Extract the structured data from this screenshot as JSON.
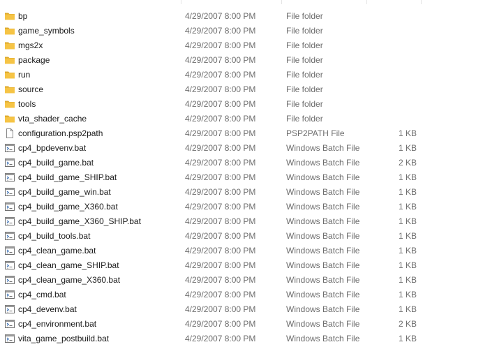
{
  "files": [
    {
      "name": "bp",
      "date": "4/29/2007 8:00 PM",
      "type": "File folder",
      "size": "",
      "icon": "folder-icon"
    },
    {
      "name": "game_symbols",
      "date": "4/29/2007 8:00 PM",
      "type": "File folder",
      "size": "",
      "icon": "folder-icon"
    },
    {
      "name": "mgs2x",
      "date": "4/29/2007 8:00 PM",
      "type": "File folder",
      "size": "",
      "icon": "folder-icon"
    },
    {
      "name": "package",
      "date": "4/29/2007 8:00 PM",
      "type": "File folder",
      "size": "",
      "icon": "folder-icon"
    },
    {
      "name": "run",
      "date": "4/29/2007 8:00 PM",
      "type": "File folder",
      "size": "",
      "icon": "folder-icon"
    },
    {
      "name": "source",
      "date": "4/29/2007 8:00 PM",
      "type": "File folder",
      "size": "",
      "icon": "folder-icon"
    },
    {
      "name": "tools",
      "date": "4/29/2007 8:00 PM",
      "type": "File folder",
      "size": "",
      "icon": "folder-icon"
    },
    {
      "name": "vta_shader_cache",
      "date": "4/29/2007 8:00 PM",
      "type": "File folder",
      "size": "",
      "icon": "folder-icon"
    },
    {
      "name": "configuration.psp2path",
      "date": "4/29/2007 8:00 PM",
      "type": "PSP2PATH File",
      "size": "1 KB",
      "icon": "file-icon"
    },
    {
      "name": "cp4_bpdevenv.bat",
      "date": "4/29/2007 8:00 PM",
      "type": "Windows Batch File",
      "size": "1 KB",
      "icon": "batch-file-icon"
    },
    {
      "name": "cp4_build_game.bat",
      "date": "4/29/2007 8:00 PM",
      "type": "Windows Batch File",
      "size": "2 KB",
      "icon": "batch-file-icon"
    },
    {
      "name": "cp4_build_game_SHIP.bat",
      "date": "4/29/2007 8:00 PM",
      "type": "Windows Batch File",
      "size": "1 KB",
      "icon": "batch-file-icon"
    },
    {
      "name": "cp4_build_game_win.bat",
      "date": "4/29/2007 8:00 PM",
      "type": "Windows Batch File",
      "size": "1 KB",
      "icon": "batch-file-icon"
    },
    {
      "name": "cp4_build_game_X360.bat",
      "date": "4/29/2007 8:00 PM",
      "type": "Windows Batch File",
      "size": "1 KB",
      "icon": "batch-file-icon"
    },
    {
      "name": "cp4_build_game_X360_SHIP.bat",
      "date": "4/29/2007 8:00 PM",
      "type": "Windows Batch File",
      "size": "1 KB",
      "icon": "batch-file-icon"
    },
    {
      "name": "cp4_build_tools.bat",
      "date": "4/29/2007 8:00 PM",
      "type": "Windows Batch File",
      "size": "1 KB",
      "icon": "batch-file-icon"
    },
    {
      "name": "cp4_clean_game.bat",
      "date": "4/29/2007 8:00 PM",
      "type": "Windows Batch File",
      "size": "1 KB",
      "icon": "batch-file-icon"
    },
    {
      "name": "cp4_clean_game_SHIP.bat",
      "date": "4/29/2007 8:00 PM",
      "type": "Windows Batch File",
      "size": "1 KB",
      "icon": "batch-file-icon"
    },
    {
      "name": "cp4_clean_game_X360.bat",
      "date": "4/29/2007 8:00 PM",
      "type": "Windows Batch File",
      "size": "1 KB",
      "icon": "batch-file-icon"
    },
    {
      "name": "cp4_cmd.bat",
      "date": "4/29/2007 8:00 PM",
      "type": "Windows Batch File",
      "size": "1 KB",
      "icon": "batch-file-icon"
    },
    {
      "name": "cp4_devenv.bat",
      "date": "4/29/2007 8:00 PM",
      "type": "Windows Batch File",
      "size": "1 KB",
      "icon": "batch-file-icon"
    },
    {
      "name": "cp4_environment.bat",
      "date": "4/29/2007 8:00 PM",
      "type": "Windows Batch File",
      "size": "2 KB",
      "icon": "batch-file-icon"
    },
    {
      "name": "vita_game_postbuild.bat",
      "date": "4/29/2007 8:00 PM",
      "type": "Windows Batch File",
      "size": "1 KB",
      "icon": "batch-file-icon"
    }
  ],
  "colors": {
    "folder": "#f6c445",
    "folder_dark": "#dca92c",
    "secondary_text": "#6d6d6d",
    "divider": "#e5e5e5"
  }
}
